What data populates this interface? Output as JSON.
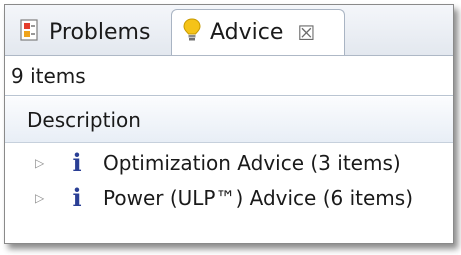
{
  "tabs": [
    {
      "label": "Problems",
      "icon": "problems-icon",
      "active": false
    },
    {
      "label": "Advice",
      "icon": "lightbulb-icon",
      "active": true,
      "close_glyph": "☒"
    }
  ],
  "status": {
    "text": "9 items"
  },
  "table": {
    "columns": [
      "Description"
    ],
    "rows": [
      {
        "label": "Optimization Advice (3 items)",
        "icon": "info-icon",
        "expanded": false
      },
      {
        "label": "Power (ULP™) Advice (6 items)",
        "icon": "info-icon",
        "expanded": false
      }
    ]
  },
  "colors": {
    "info_icon": "#2a3f95",
    "lightbulb": "#f5c318",
    "tab_border": "#a9b4c3"
  }
}
